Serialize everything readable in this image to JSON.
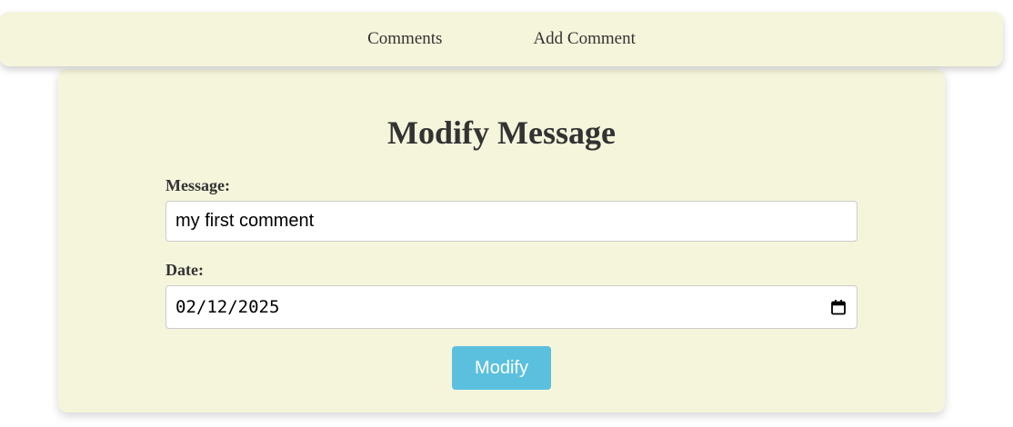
{
  "nav": {
    "links": [
      {
        "label": "Comments"
      },
      {
        "label": "Add Comment"
      }
    ]
  },
  "form": {
    "title": "Modify Message",
    "message_label": "Message:",
    "message_value": "my first comment",
    "date_label": "Date:",
    "date_value": "02/12/2025",
    "date_icon": "calendar-icon",
    "submit_label": "Modify"
  },
  "colors": {
    "panel_background": "#f5f5dc",
    "button_background": "#5bc0de",
    "button_text": "#ffffff",
    "text": "#333333"
  }
}
